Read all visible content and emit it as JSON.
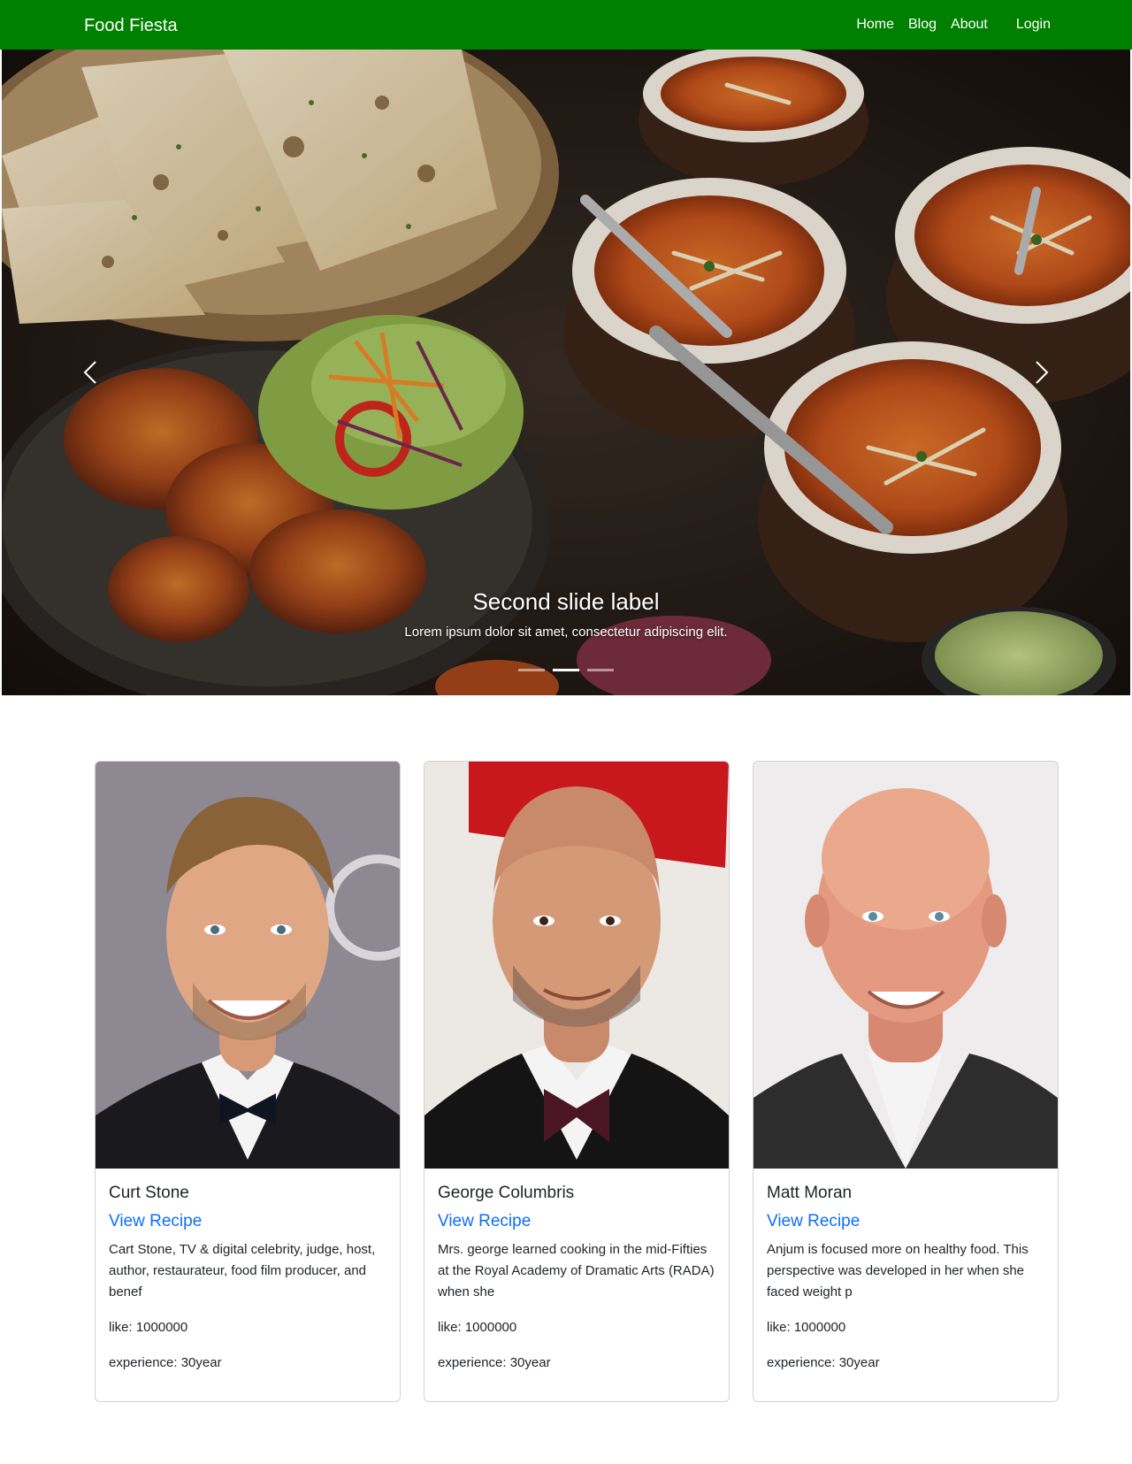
{
  "navbar": {
    "brand": "Food Fiesta",
    "links": [
      "Home",
      "Blog",
      "About",
      "Login"
    ],
    "bg_color": "#008000"
  },
  "carousel": {
    "caption_title": "Second slide label",
    "caption_text": "Lorem ipsum dolor sit amet, consectetur adipiscing elit.",
    "prev_icon": "chevron-left-icon",
    "next_icon": "chevron-right-icon",
    "slide_count": 3,
    "active_slide": 2
  },
  "cards": [
    {
      "name": "Curt Stone",
      "link": "View Recipe",
      "description": "Cart Stone, TV & digital celebrity, judge, host, author, restaurateur, food film producer, and benef",
      "likes": "like: 1000000",
      "experience": "experience: 30year"
    },
    {
      "name": "George Columbris",
      "link": "View Recipe",
      "description": "Mrs. george learned cooking in the mid-Fifties at the Royal Academy of Dramatic Arts (RADA) when she",
      "likes": "like: 1000000",
      "experience": "experience: 30year"
    },
    {
      "name": "Matt Moran",
      "link": "View Recipe",
      "description": "Anjum is focused more on healthy food. This perspective was developed in her when she faced weight p",
      "likes": "like: 1000000",
      "experience": "experience: 30year"
    }
  ],
  "colors": {
    "link": "#0d6efd",
    "text": "#212529"
  }
}
